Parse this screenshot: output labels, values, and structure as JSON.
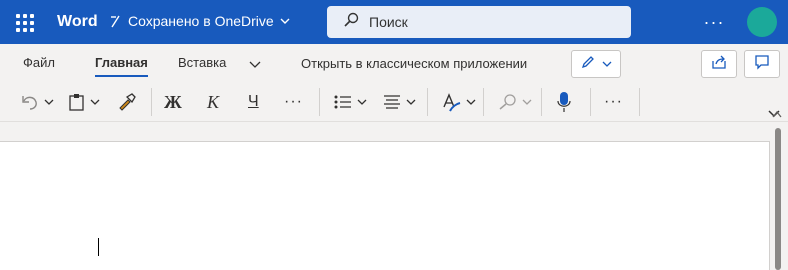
{
  "titlebar": {
    "app_name": "Word",
    "save_status": "Сохранено в OneDrive",
    "search_placeholder": "Поиск",
    "more_label": "···"
  },
  "ribbon": {
    "tabs": [
      {
        "label": "Файл",
        "active": false
      },
      {
        "label": "Главная",
        "active": true
      },
      {
        "label": "Вставка",
        "active": false
      }
    ],
    "open_desktop_label": "Открыть в классическом приложении",
    "tools": {
      "bold": "Ж",
      "italic": "К",
      "underline": "Ч",
      "more": "···",
      "more2": "···"
    }
  },
  "icons": [
    "waffle-icon",
    "document-icon",
    "chevron-down-icon",
    "search-icon",
    "undo-icon",
    "paste-icon",
    "format-painter-icon",
    "bullets-icon",
    "align-icon",
    "font-color-icon",
    "find-icon",
    "dictate-icon",
    "pencil-icon",
    "share-icon",
    "comment-icon"
  ],
  "colors": {
    "brand": "#185abd",
    "avatar": "#1ba99a",
    "ribbon_bg": "#f3f2f1",
    "dictate": "#185abd"
  }
}
